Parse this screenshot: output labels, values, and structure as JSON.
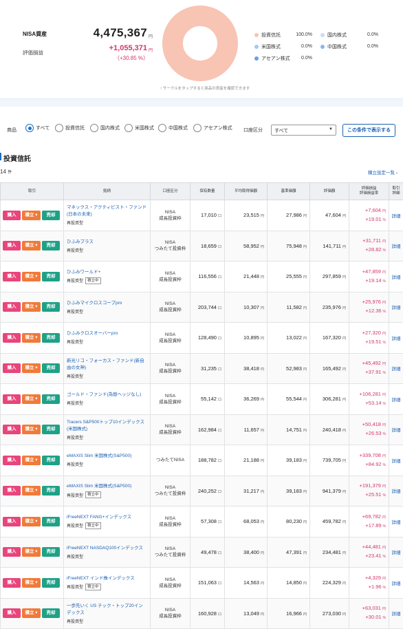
{
  "summary": {
    "nisa_label": "NISA資産",
    "valuation_label": "評価損益",
    "total_amount": "4,475,367",
    "yen": "円",
    "pl_amount": "+1,055,371",
    "pl_percent": "（+30.85 %）",
    "chart_note": "サークルをタップすると商品の資産を確認できます",
    "allocation": [
      {
        "name": "投資信託",
        "value": "100.0%",
        "color": "#f8c4b4"
      },
      {
        "name": "米国株式",
        "value": "0.0%",
        "color": "#a8c6f0"
      },
      {
        "name": "アセアン株式",
        "value": "0.0%",
        "color": "#6a9ee8"
      },
      {
        "name": "国内株式",
        "value": "0.0%",
        "color": "#c9dcf5"
      },
      {
        "name": "中国株式",
        "value": "0.0%",
        "color": "#8fb4ea"
      }
    ]
  },
  "chart_data": {
    "type": "pie",
    "categories": [
      "投資信託",
      "米国株式",
      "アセアン株式",
      "国内株式",
      "中国株式"
    ],
    "values": [
      100.0,
      0.0,
      0.0,
      0.0,
      0.0
    ]
  },
  "filter": {
    "product_label": "商品",
    "options": [
      "すべて",
      "投資信託",
      "国内株式",
      "米国株式",
      "中国株式",
      "アセアン株式"
    ],
    "account_label": "口座区分",
    "account_value": "すべて",
    "search_button": "この条件で表示する"
  },
  "section": {
    "title": "投資信託",
    "count": "14",
    "count_unit": "件",
    "settings_link": "積立設定一覧 ›"
  },
  "table": {
    "headers": {
      "trade": "取引",
      "name": "銘柄",
      "account": "口座区分",
      "qty": "保有数量",
      "avg": "平均取得価額",
      "price": "基準価額",
      "value": "評価額",
      "pl1": "評価損益",
      "pl2": "評価損益率",
      "detail1": "取引",
      "detail2": "詳細"
    },
    "labels": {
      "buy": "購入",
      "accumulate": "積立 ▾",
      "sell": "売却",
      "reinvest": "再投資型",
      "detail": "詳細",
      "qty_unit": "口",
      "yen": "円",
      "pct": "%"
    },
    "rows": [
      {
        "name": "マネックス・アクティビスト・ファンド(日本の未来)",
        "tag": "",
        "acct1": "NISA",
        "acct2": "成長投資枠",
        "qty": "17,010",
        "avg": "23,515",
        "price": "27,986",
        "value": "47,604",
        "pl": "+7,604",
        "plp": "+19.01"
      },
      {
        "name": "ひふみプラス",
        "tag": "",
        "acct1": "NISA",
        "acct2": "つみたて投資枠",
        "qty": "18,659",
        "avg": "58,952",
        "price": "75,948",
        "value": "141,711",
        "pl": "+31,711",
        "plp": "+28.82"
      },
      {
        "name": "ひふみワールド+",
        "tag": "積立中",
        "acct1": "NISA",
        "acct2": "成長投資枠",
        "qty": "116,556",
        "avg": "21,448",
        "price": "25,555",
        "value": "297,859",
        "pl": "+47,859",
        "plp": "+19.14"
      },
      {
        "name": "ひふみマイクロスコープpro",
        "tag": "",
        "acct1": "NISA",
        "acct2": "成長投資枠",
        "qty": "203,744",
        "avg": "10,307",
        "price": "11,582",
        "value": "235,976",
        "pl": "+25,976",
        "plp": "+12.36"
      },
      {
        "name": "ひふみクロスオーバーpro",
        "tag": "",
        "acct1": "NISA",
        "acct2": "成長投資枠",
        "qty": "128,490",
        "avg": "10,895",
        "price": "13,022",
        "value": "167,320",
        "pl": "+27,320",
        "plp": "+19.51"
      },
      {
        "name": "新光リコ・フォーカス・ファンド(新自由の女神)",
        "tag": "",
        "acct1": "NISA",
        "acct2": "成長投資枠",
        "qty": "31,235",
        "avg": "38,418",
        "price": "52,983",
        "value": "165,492",
        "pl": "+45,492",
        "plp": "+37.91"
      },
      {
        "name": "ゴールド・ファンド(為替ヘッジなし)",
        "tag": "",
        "acct1": "NISA",
        "acct2": "成長投資枠",
        "qty": "55,142",
        "avg": "36,269",
        "price": "55,544",
        "value": "306,281",
        "pl": "+106,281",
        "plp": "+53.14"
      },
      {
        "name": "Tracers S&P500トップ10インデックス(米国株式)",
        "tag": "",
        "acct1": "NISA",
        "acct2": "成長投資枠",
        "qty": "162,984",
        "avg": "11,657",
        "price": "14,751",
        "value": "240,418",
        "pl": "+50,418",
        "plp": "+26.53"
      },
      {
        "name": "eMAXIS Slim 米国株式(S&P500)",
        "tag": "",
        "acct1": "つみたてNISA",
        "acct2": "",
        "qty": "188,782",
        "avg": "21,188",
        "price": "39,183",
        "value": "739,705",
        "pl": "+339,708",
        "plp": "+84.92"
      },
      {
        "name": "eMAXIS Slim 米国株式(S&P500)",
        "tag": "積立中",
        "acct1": "NISA",
        "acct2": "つみたて投資枠",
        "qty": "240,252",
        "avg": "31,217",
        "price": "39,183",
        "value": "941,379",
        "pl": "+191,379",
        "plp": "+25.51"
      },
      {
        "name": "iFreeNEXT FANG+インデックス",
        "tag": "積立中",
        "acct1": "NISA",
        "acct2": "成長投資枠",
        "qty": "57,308",
        "avg": "68,053",
        "price": "80,230",
        "value": "459,782",
        "pl": "+69,782",
        "plp": "+17.89"
      },
      {
        "name": "iFreeNEXT NASDAQ100インデックス",
        "tag": "",
        "acct1": "NISA",
        "acct2": "つみたて投資枠",
        "qty": "49,478",
        "avg": "38,400",
        "price": "47,391",
        "value": "234,481",
        "pl": "+44,481",
        "plp": "+23.41"
      },
      {
        "name": "iFreeNEXT インド株インデックス",
        "tag": "積立中",
        "acct1": "NISA",
        "acct2": "成長投資枠",
        "qty": "151,063",
        "avg": "14,563",
        "price": "14,850",
        "value": "224,329",
        "pl": "+4,329",
        "plp": "+1.96"
      },
      {
        "name": "一歩先いく US テック・トップ20インデックス",
        "tag": "",
        "acct1": "NISA",
        "acct2": "成長投資枠",
        "qty": "160,928",
        "avg": "13,049",
        "price": "16,966",
        "value": "273,030",
        "pl": "+63,031",
        "plp": "+30.01"
      }
    ]
  }
}
